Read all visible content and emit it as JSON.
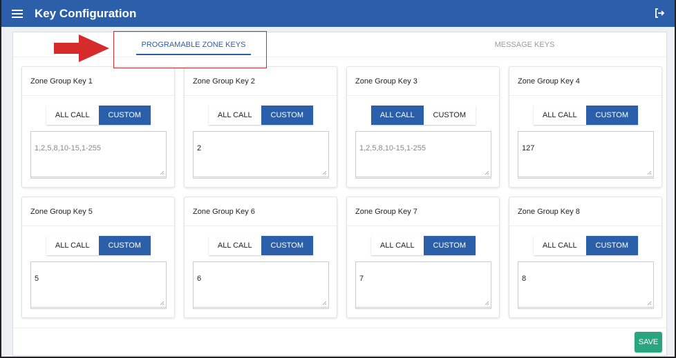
{
  "app": {
    "title": "Key Configuration",
    "menu_icon": "hamburger-menu-icon",
    "logout_icon": "logout-icon",
    "accent_color": "#2c5faa",
    "save_color": "#2aa57f",
    "annotation_color": "#d62b2b"
  },
  "tabs": [
    {
      "label": "PROGRAMABLE ZONE KEYS",
      "active": true
    },
    {
      "label": "MESSAGE KEYS",
      "active": false
    }
  ],
  "zones": [
    {
      "title": "Zone Group Key 1",
      "all_call_label": "ALL CALL",
      "custom_label": "CUSTOM",
      "mode": "custom",
      "value": "",
      "placeholder": "1,2,5,8,10-15,1-255"
    },
    {
      "title": "Zone Group Key 2",
      "all_call_label": "ALL CALL",
      "custom_label": "CUSTOM",
      "mode": "custom",
      "value": "2",
      "placeholder": ""
    },
    {
      "title": "Zone Group Key 3",
      "all_call_label": "ALL CALL",
      "custom_label": "CUSTOM",
      "mode": "all_call",
      "value": "",
      "placeholder": "1,2,5,8,10-15,1-255"
    },
    {
      "title": "Zone Group Key 4",
      "all_call_label": "ALL CALL",
      "custom_label": "CUSTOM",
      "mode": "custom",
      "value": "127",
      "placeholder": ""
    },
    {
      "title": "Zone Group Key 5",
      "all_call_label": "ALL CALL",
      "custom_label": "CUSTOM",
      "mode": "custom",
      "value": "5",
      "placeholder": ""
    },
    {
      "title": "Zone Group Key 6",
      "all_call_label": "ALL CALL",
      "custom_label": "CUSTOM",
      "mode": "custom",
      "value": "6",
      "placeholder": ""
    },
    {
      "title": "Zone Group Key 7",
      "all_call_label": "ALL CALL",
      "custom_label": "CUSTOM",
      "mode": "custom",
      "value": "7",
      "placeholder": ""
    },
    {
      "title": "Zone Group Key 8",
      "all_call_label": "ALL CALL",
      "custom_label": "CUSTOM",
      "mode": "custom",
      "value": "8",
      "placeholder": ""
    }
  ],
  "footer": {
    "save_label": "SAVE"
  }
}
